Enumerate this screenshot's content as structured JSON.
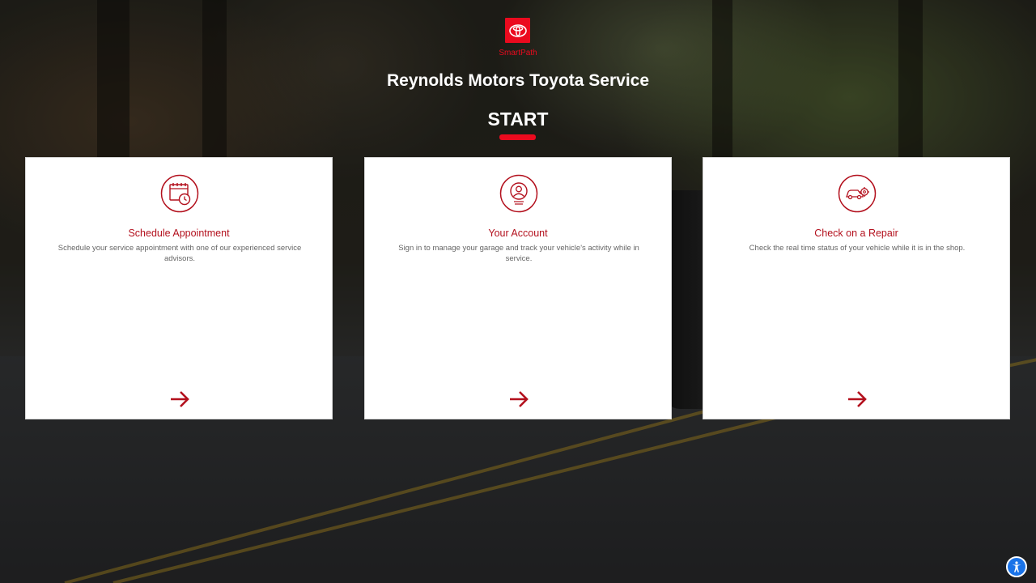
{
  "header": {
    "logo_text": "SmartPath",
    "site_title": "Reynolds Motors Toyota Service",
    "page_heading": "START"
  },
  "cards": [
    {
      "title": "Schedule Appointment",
      "description": "Schedule your service appointment with one of our experienced service advisors.",
      "icon": "calendar-clock-icon"
    },
    {
      "title": "Your Account",
      "description": "Sign in to manage your garage and track your vehicle's activity while in service.",
      "icon": "user-account-icon"
    },
    {
      "title": "Check on a Repair",
      "description": "Check the real time status of your vehicle while it is in the shop.",
      "icon": "car-repair-icon"
    }
  ],
  "colors": {
    "brand_red": "#eb0a1e",
    "card_title": "#b3101d",
    "accessibility_blue": "#1a73e8"
  },
  "accessibility": {
    "icon": "accessibility-icon"
  }
}
